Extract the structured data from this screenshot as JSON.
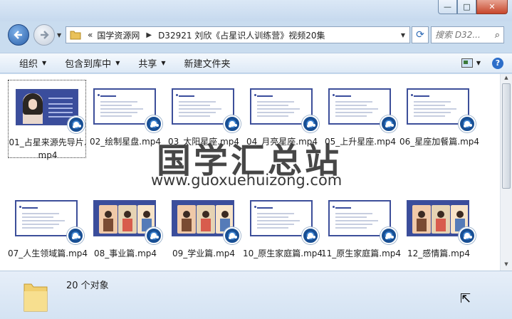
{
  "window": {
    "controls": [
      "—",
      "□",
      "✕"
    ]
  },
  "nav": {
    "back_icon": "back-arrow-icon",
    "forward_icon": "forward-arrow-icon",
    "path_prefix": "«",
    "path": [
      "国学资源网",
      "D32921  刘欣《占星识人训练营》视频20集"
    ],
    "search_placeholder": "搜索 D32..."
  },
  "toolbar": {
    "organize": "组织",
    "include_library": "包含到库中",
    "share": "共享",
    "new_folder": "新建文件夹"
  },
  "files": [
    {
      "name": "01_占星来源先导片.mp4",
      "row": 0,
      "col": 0
    },
    {
      "name": "02_绘制星盘.mp4",
      "row": 0,
      "col": 1
    },
    {
      "name": "03_太阳星座.mp4",
      "row": 0,
      "col": 2
    },
    {
      "name": "04_月亮星座.mp4",
      "row": 0,
      "col": 3
    },
    {
      "name": "05_上升星座.mp4",
      "row": 0,
      "col": 4
    },
    {
      "name": "06_星座加餐篇.mp4",
      "row": 0,
      "col": 5
    },
    {
      "name": "07_人生领域篇.mp4",
      "row": 1,
      "col": 0
    },
    {
      "name": "08_事业篇.mp4",
      "row": 1,
      "col": 1
    },
    {
      "name": "09_学业篇.mp4",
      "row": 1,
      "col": 2
    },
    {
      "name": "10_原生家庭篇.mp4",
      "row": 1,
      "col": 3
    },
    {
      "name": "11_原生家庭篇.mp4",
      "row": 1,
      "col": 4
    },
    {
      "name": "12_感情篇.mp4",
      "row": 1,
      "col": 5
    }
  ],
  "watermark": {
    "title": "国学汇总站",
    "url": "www.guoxuehuizong.com"
  },
  "status": {
    "count": "20 个对象"
  },
  "colors": {
    "slide_blue": "#3a4d9c",
    "window_bg": "#c9dcef"
  }
}
